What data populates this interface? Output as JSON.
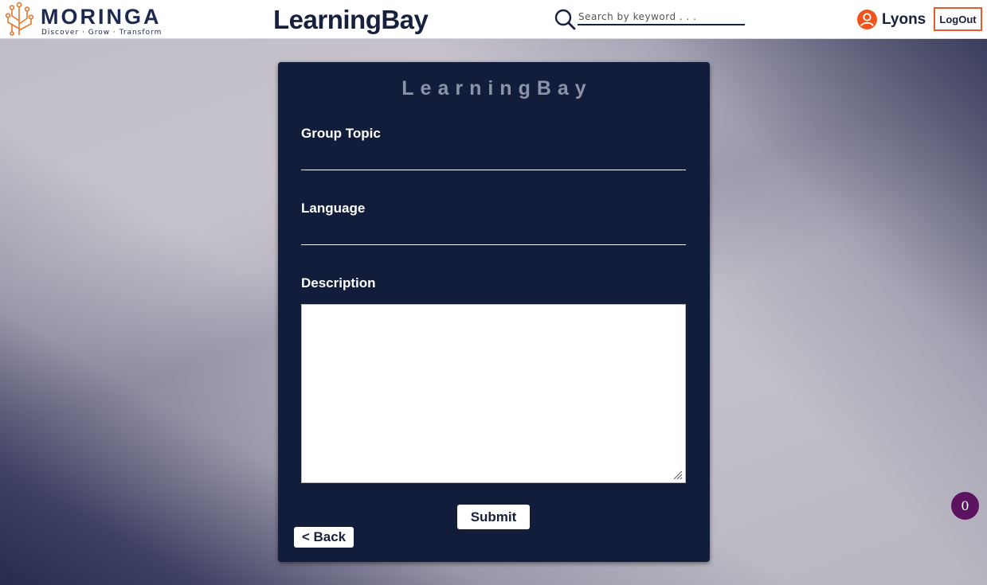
{
  "header": {
    "logo": {
      "word": "MORINGA",
      "tagline": "Discover · Grow · Transform"
    },
    "brand": "LearningBay",
    "search": {
      "placeholder": "Search by keyword . . .",
      "value": "",
      "icon": "search-icon"
    },
    "user": {
      "name": "Lyons",
      "icon": "user-icon"
    },
    "logout_label": "LogOut"
  },
  "form": {
    "title": "LearningBay",
    "fields": {
      "group_topic": {
        "label": "Group Topic",
        "value": ""
      },
      "language": {
        "label": "Language",
        "value": ""
      },
      "description": {
        "label": "Description",
        "value": ""
      }
    },
    "submit_label": "Submit",
    "back_label": "< Back"
  },
  "badge": {
    "count": "0"
  },
  "colors": {
    "navy": "#121d3c",
    "brand_text": "#17203d",
    "accent_orange": "#e85d2a",
    "badge_purple": "#5c1460"
  }
}
